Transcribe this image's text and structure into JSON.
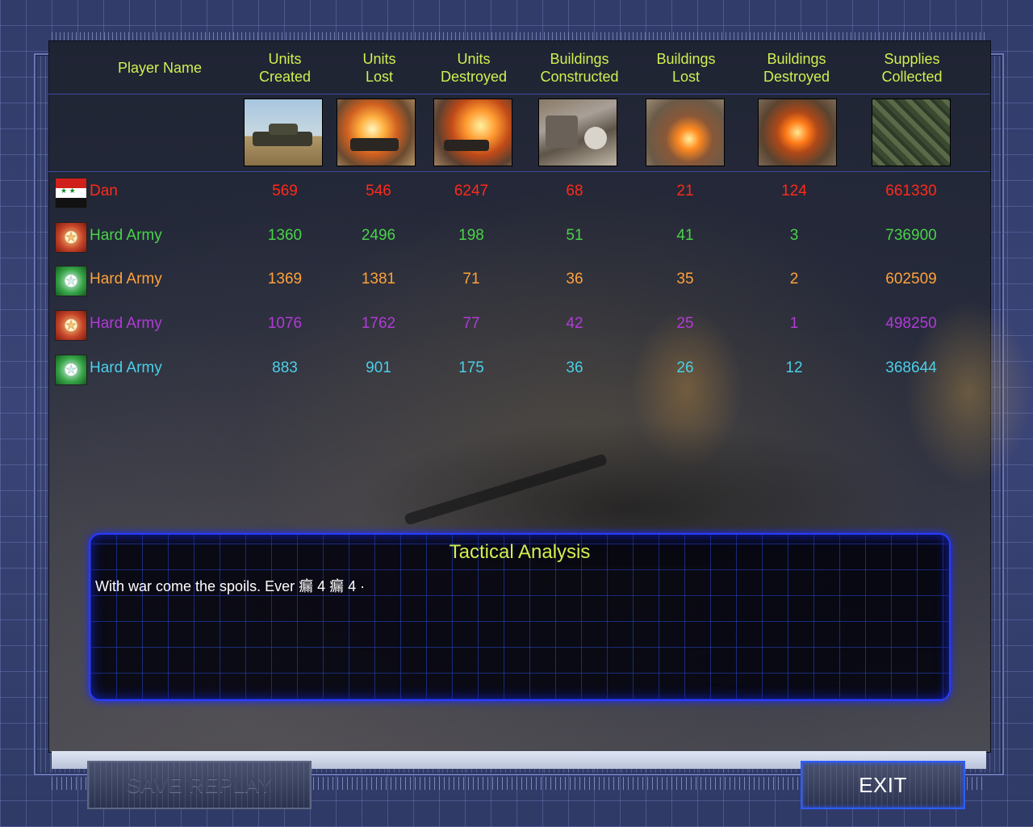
{
  "headers": {
    "player_name": "Player Name",
    "units_created": [
      "Units",
      "Created"
    ],
    "units_lost": [
      "Units",
      "Lost"
    ],
    "units_destroyed": [
      "Units",
      "Destroyed"
    ],
    "buildings_constructed": [
      "Buildings",
      "Constructed"
    ],
    "buildings_lost": [
      "Buildings",
      "Lost"
    ],
    "buildings_destroyed": [
      "Buildings",
      "Destroyed"
    ],
    "supplies_collected": [
      "Supplies",
      "Collected"
    ]
  },
  "players": [
    {
      "name": "Dan",
      "emblem": "syria-flag-icon",
      "units_created": "569",
      "units_lost": "546",
      "units_destroyed": "6247",
      "buildings_constructed": "68",
      "buildings_lost": "21",
      "buildings_destroyed": "124",
      "supplies_collected": "661330",
      "color": "#ff2a1a"
    },
    {
      "name": "Hard Army",
      "emblem": "red-faction-emblem-icon",
      "units_created": "1360",
      "units_lost": "2496",
      "units_destroyed": "198",
      "buildings_constructed": "51",
      "buildings_lost": "41",
      "buildings_destroyed": "3",
      "supplies_collected": "736900",
      "color": "#4ad24a"
    },
    {
      "name": "Hard Army",
      "emblem": "green-faction-emblem-icon",
      "units_created": "1369",
      "units_lost": "1381",
      "units_destroyed": "71",
      "buildings_constructed": "36",
      "buildings_lost": "35",
      "buildings_destroyed": "2",
      "supplies_collected": "602509",
      "color": "#ffa23a"
    },
    {
      "name": "Hard Army",
      "emblem": "red-faction-emblem-icon",
      "units_created": "1076",
      "units_lost": "1762",
      "units_destroyed": "77",
      "buildings_constructed": "42",
      "buildings_lost": "25",
      "buildings_destroyed": "1",
      "supplies_collected": "498250",
      "color": "#b23ad8"
    },
    {
      "name": "Hard Army",
      "emblem": "green-faction-emblem-icon",
      "units_created": "883",
      "units_lost": "901",
      "units_destroyed": "175",
      "buildings_constructed": "36",
      "buildings_lost": "26",
      "buildings_destroyed": "12",
      "supplies_collected": "368644",
      "color": "#4ad0e8"
    }
  ],
  "tactical": {
    "title": "Tactical Analysis",
    "text": "With war come the spoils. Ever 瘺 4 瘺 4 ·"
  },
  "buttons": {
    "save_replay": "SAVE REPLAY",
    "exit": "EXIT"
  }
}
